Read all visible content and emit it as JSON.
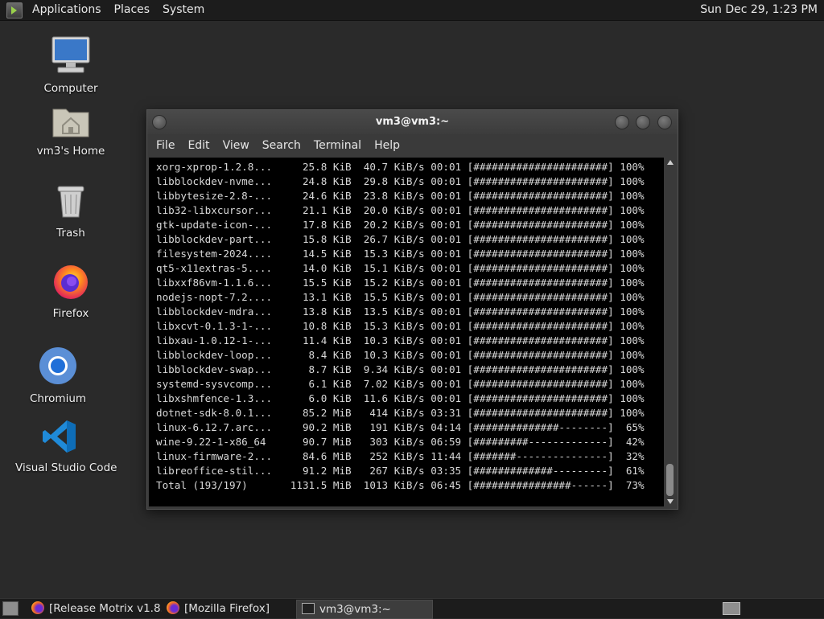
{
  "top_panel": {
    "menus": [
      "Applications",
      "Places",
      "System"
    ],
    "clock": "Sun Dec 29,  1:23 PM"
  },
  "desktop_icons": [
    {
      "label": "Computer",
      "icon": "computer-icon"
    },
    {
      "label": "vm3's Home",
      "icon": "home-folder-icon"
    },
    {
      "label": "Trash",
      "icon": "trash-icon"
    },
    {
      "label": "Firefox",
      "icon": "firefox-icon"
    },
    {
      "label": "Chromium",
      "icon": "chromium-icon"
    },
    {
      "label": "Visual Studio Code",
      "icon": "vscode-icon"
    }
  ],
  "terminal": {
    "title": "vm3@vm3:~",
    "menu": [
      "File",
      "Edit",
      "View",
      "Search",
      "Terminal",
      "Help"
    ],
    "lines": [
      "xorg-xprop-1.2.8...     25.8 KiB  40.7 KiB/s 00:01 [######################] 100%",
      "libblockdev-nvme...     24.8 KiB  29.8 KiB/s 00:01 [######################] 100%",
      "libbytesize-2.8-...     24.6 KiB  23.8 KiB/s 00:01 [######################] 100%",
      "lib32-libxcursor...     21.1 KiB  20.0 KiB/s 00:01 [######################] 100%",
      "gtk-update-icon-...     17.8 KiB  20.2 KiB/s 00:01 [######################] 100%",
      "libblockdev-part...     15.8 KiB  26.7 KiB/s 00:01 [######################] 100%",
      "filesystem-2024....     14.5 KiB  15.3 KiB/s 00:01 [######################] 100%",
      "qt5-x11extras-5....     14.0 KiB  15.1 KiB/s 00:01 [######################] 100%",
      "libxxf86vm-1.1.6...     15.5 KiB  15.2 KiB/s 00:01 [######################] 100%",
      "nodejs-nopt-7.2....     13.1 KiB  15.5 KiB/s 00:01 [######################] 100%",
      "libblockdev-mdra...     13.8 KiB  13.5 KiB/s 00:01 [######################] 100%",
      "libxcvt-0.1.3-1-...     10.8 KiB  15.3 KiB/s 00:01 [######################] 100%",
      "libxau-1.0.12-1-...     11.4 KiB  10.3 KiB/s 00:01 [######################] 100%",
      "libblockdev-loop...      8.4 KiB  10.3 KiB/s 00:01 [######################] 100%",
      "libblockdev-swap...      8.7 KiB  9.34 KiB/s 00:01 [######################] 100%",
      "systemd-sysvcomp...      6.1 KiB  7.02 KiB/s 00:01 [######################] 100%",
      "libxshmfence-1.3...      6.0 KiB  11.6 KiB/s 00:01 [######################] 100%",
      "dotnet-sdk-8.0.1...     85.2 MiB   414 KiB/s 03:31 [######################] 100%",
      "linux-6.12.7.arc...     90.2 MiB   191 KiB/s 04:14 [##############--------]  65%",
      "wine-9.22-1-x86_64      90.7 MiB   303 KiB/s 06:59 [#########-------------]  42%",
      "linux-firmware-2...     84.6 MiB   252 KiB/s 11:44 [#######---------------]  32%",
      "libreoffice-stil...     91.2 MiB   267 KiB/s 03:35 [#############---------]  61%",
      "Total (193/197)       1131.5 MiB  1013 KiB/s 06:45 [################------]  73%"
    ]
  },
  "taskbar": {
    "tasks": [
      {
        "label": "[Release Motrix v1.8....",
        "icon": "firefox-icon",
        "active": false
      },
      {
        "label": "[Mozilla Firefox]",
        "icon": "firefox-icon",
        "active": false
      },
      {
        "label": "vm3@vm3:~",
        "icon": "terminal-icon",
        "active": true
      }
    ]
  }
}
